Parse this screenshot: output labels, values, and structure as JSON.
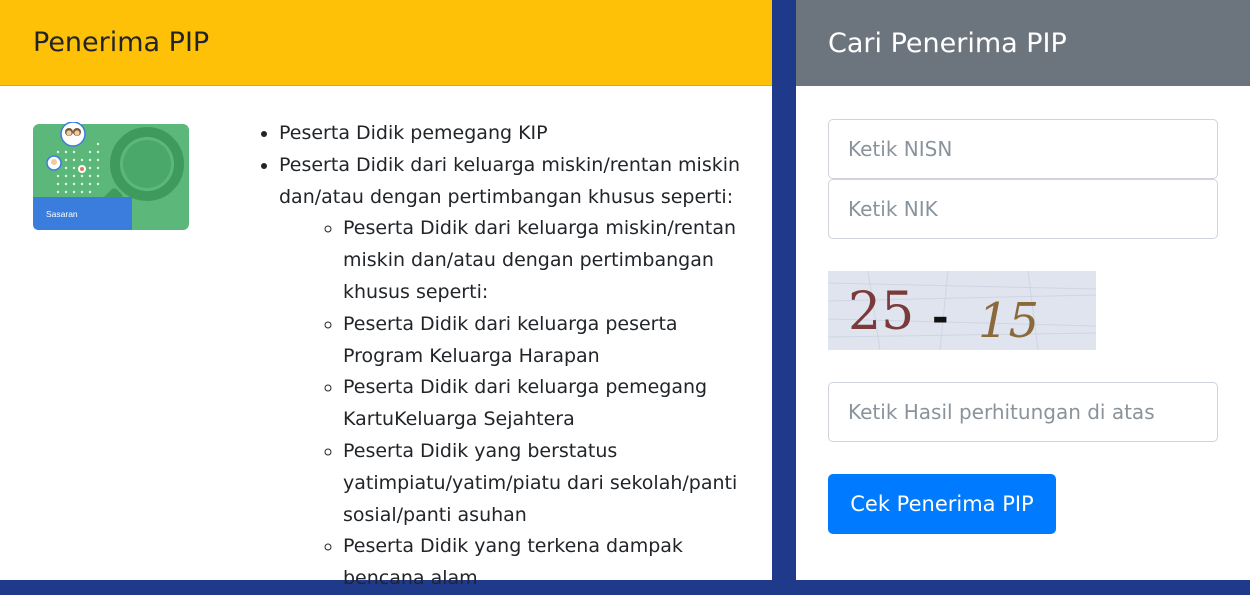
{
  "left_card": {
    "title": "Penerima PIP",
    "illustration_label": "Sasaran",
    "main_items": [
      "Peserta Didik pemegang KIP",
      "Peserta Didik dari keluarga miskin/rentan miskin dan/atau dengan pertimbangan khusus seperti:"
    ],
    "sub_items": [
      "Peserta Didik dari keluarga miskin/rentan miskin dan/atau dengan pertimbangan khusus seperti:",
      "Peserta Didik dari keluarga peserta Program Keluarga Harapan",
      "Peserta Didik dari keluarga pemegang KartuKeluarga Sejahtera",
      "Peserta Didik yang berstatus yatimpiatu/yatim/piatu dari sekolah/panti sosial/panti asuhan",
      "Peserta Didik yang terkena dampak bencana alam"
    ]
  },
  "right_card": {
    "title": "Cari Penerima PIP",
    "nisn_placeholder": "Ketik NISN",
    "nik_placeholder": "Ketik NIK",
    "captcha_left": "25",
    "captcha_op": "-",
    "captcha_right": "15",
    "result_placeholder": "Ketik Hasil perhitungan di atas",
    "submit_label": "Cek Penerima PIP"
  },
  "colors": {
    "left_header": "#ffc107",
    "right_header": "#6c757d",
    "primary_button": "#007bff",
    "page_background": "#1f3a8a",
    "illustration_green": "#5cb87a",
    "illustration_blue": "#3b7ddd"
  },
  "icons": {
    "illustration": "magnifier-with-people-illustration"
  }
}
